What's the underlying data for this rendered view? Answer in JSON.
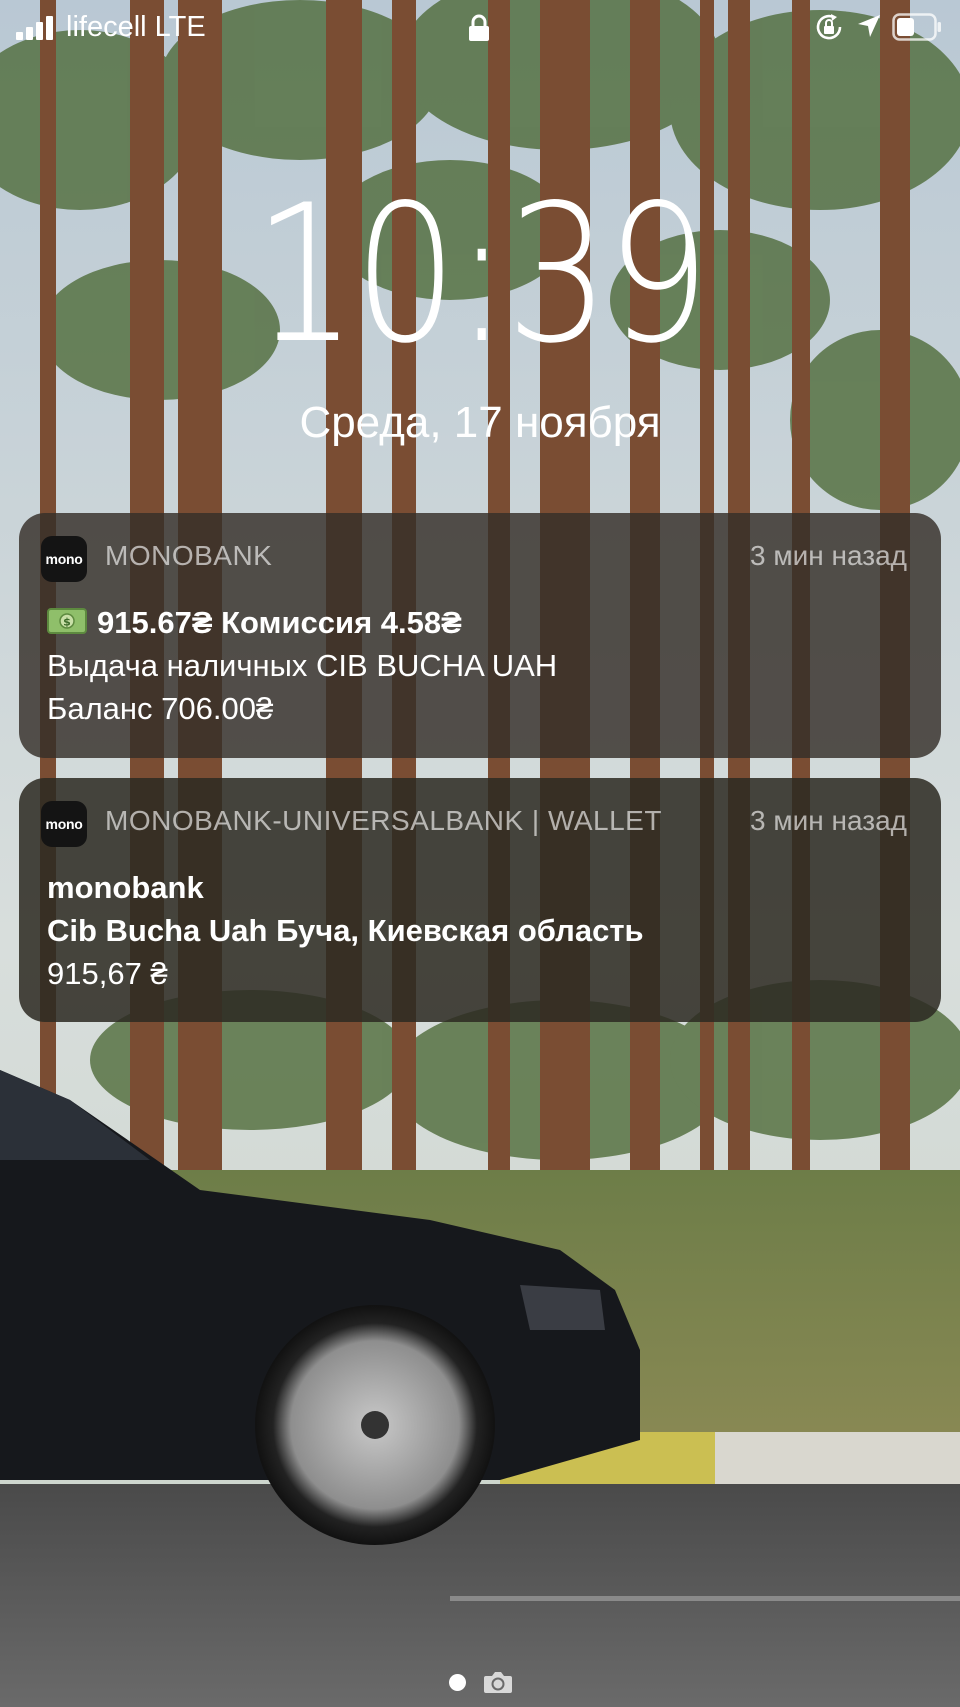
{
  "status_bar": {
    "carrier": "lifecell  LTE",
    "icons": [
      "signal-icon",
      "lock-icon",
      "rotation-lock-icon",
      "location-icon",
      "battery-icon"
    ]
  },
  "lock_screen": {
    "time": "10:39",
    "date": "Среда, 17 ноября"
  },
  "notifications": [
    {
      "app_icon_text": "mono",
      "app_name": "MONOBANK",
      "time": "3 мин назад",
      "lines": [
        "915.67₴ Комиссия 4.58₴",
        "Выдача наличных CIB BUCHA UAH",
        "Баланс 706.00₴"
      ]
    },
    {
      "app_icon_text": "mono",
      "app_name": "MONOBANK-UNIVERSALBANK | WALLET",
      "time": "3 мин назад",
      "lines": [
        "monobank",
        "Cib Bucha Uah  Буча, Киевская область",
        "915,67 ₴"
      ]
    }
  ],
  "colors": {
    "notification_bg": "#342e28",
    "text": "#ffffff",
    "secondary_text": "#b5b0aa"
  }
}
